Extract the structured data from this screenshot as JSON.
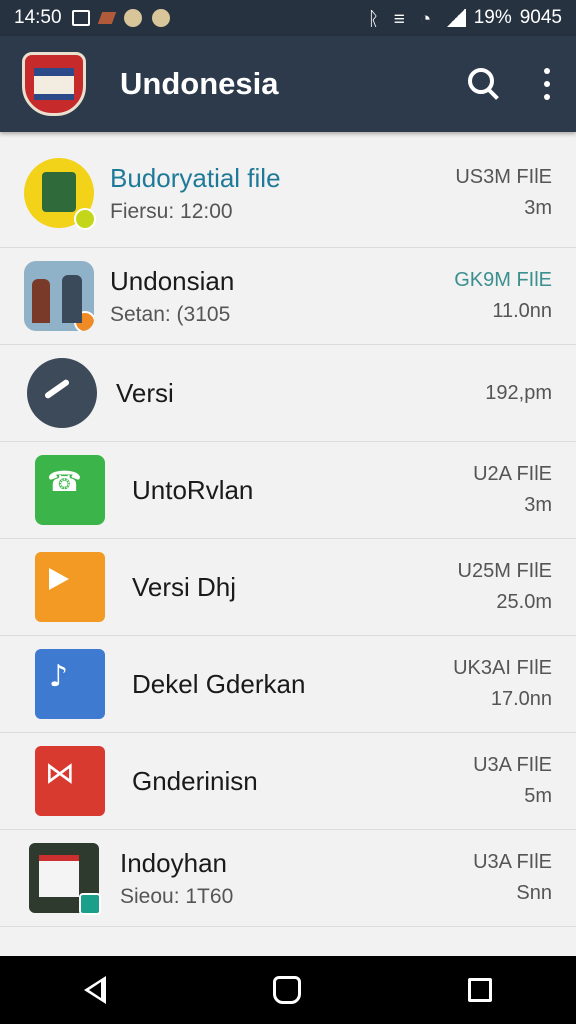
{
  "status_bar": {
    "time": "14:50",
    "battery": "19%",
    "extra": "9045",
    "icons": [
      "image-icon",
      "tool-icon",
      "app-icon",
      "app-icon-2",
      "bluetooth-icon",
      "vibrate-icon",
      "wifi-icon",
      "signal-icon"
    ]
  },
  "app_bar": {
    "title": "Undonesia",
    "icons": [
      "logo-icon",
      "search-icon",
      "more-icon"
    ]
  },
  "list": {
    "items": [
      {
        "title": "Budoryatial file",
        "subtitle": "Fiersu: 12:00",
        "meta1": "US3M FIlE",
        "meta2": "3m",
        "icon": "folder-icon"
      },
      {
        "title": "Undonsian",
        "subtitle": "Setan: (3105",
        "meta1": "GK9M FIlE",
        "meta2": "11.0nn",
        "icon": "photo-icon"
      },
      {
        "title": "Versi",
        "subtitle": "",
        "meta1": "192,pm",
        "meta2": "",
        "icon": "share-icon"
      },
      {
        "title": "UntoRvlan",
        "subtitle": "",
        "meta1": "U2A FIlE",
        "meta2": "3m",
        "icon": "phone-icon"
      },
      {
        "title": "Versi Dhj",
        "subtitle": "",
        "meta1": "U25M FIlE",
        "meta2": "25.0m",
        "icon": "play-icon"
      },
      {
        "title": "Dekel Gderkan",
        "subtitle": "",
        "meta1": "UK3AI FIlE",
        "meta2": "17.0nn",
        "icon": "music-icon"
      },
      {
        "title": "Gnderinisn",
        "subtitle": "",
        "meta1": "U3A FIlE",
        "meta2": "5m",
        "icon": "code-icon"
      },
      {
        "title": "Indoyhan",
        "subtitle": "Sieou: 1T60",
        "meta1": "U3A FIlE",
        "meta2": "Snn",
        "icon": "document-icon"
      }
    ]
  },
  "nav_bar": {
    "icons": [
      "back-icon",
      "home-icon",
      "recent-apps-icon"
    ]
  },
  "colors": {
    "app_bar": "#2c3a4b",
    "status_bar": "#263240",
    "accent_title": "#1f7a9a",
    "meta_teal": "#3c8f8f"
  }
}
